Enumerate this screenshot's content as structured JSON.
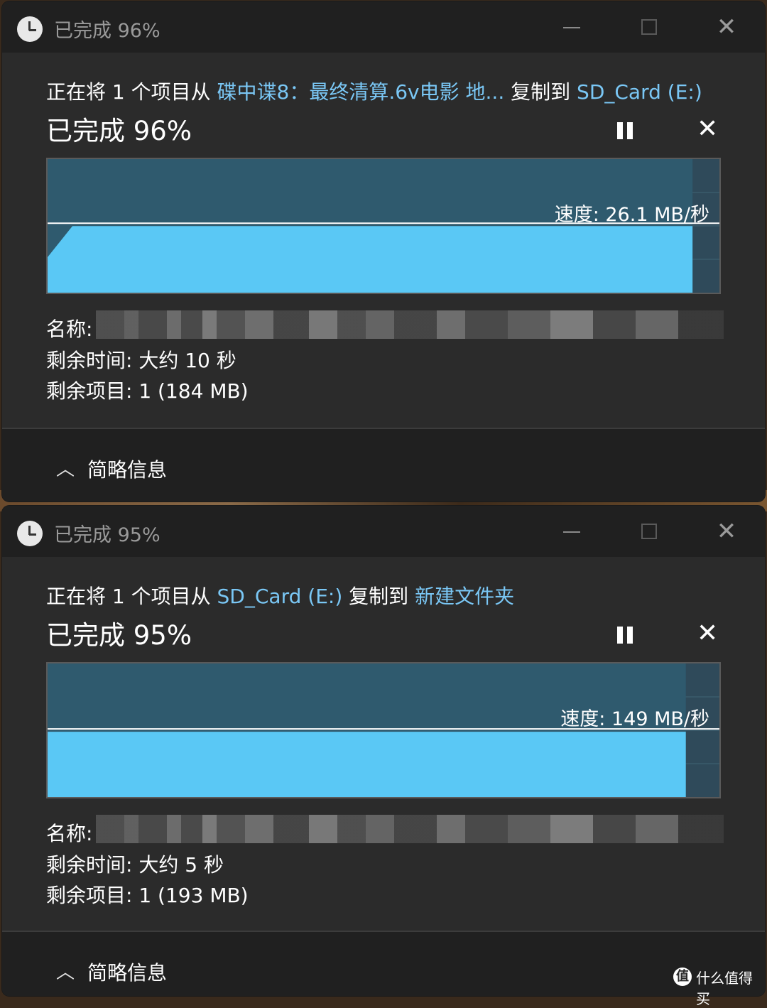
{
  "dialogs": [
    {
      "window_title": "已完成 96%",
      "copy_prefix": "正在将 1 个项目从 ",
      "source": "碟中谍8：最终清算.6v电影 地...",
      "copy_mid": " 复制到 ",
      "destination": "SD_Card (E:)",
      "percent_text": "已完成 96%",
      "progress": 0.96,
      "speed_text": "速度: 26.1 MB/秒",
      "speed_level": 0.52,
      "name_label": "名称:",
      "time_left": "剩余时间: 大约 10 秒",
      "items_left": "剩余项目: 1 (184 MB)",
      "collapse_label": "简略信息"
    },
    {
      "window_title": "已完成 95%",
      "copy_prefix": "正在将 1 个项目从 ",
      "source": "SD_Card (E:)",
      "copy_mid": " 复制到 ",
      "destination": "新建文件夹",
      "percent_text": "已完成 95%",
      "progress": 0.95,
      "speed_text": "速度: 149 MB/秒",
      "speed_level": 0.51,
      "name_label": "名称:",
      "time_left": "剩余时间: 大约 5 秒",
      "items_left": "剩余项目: 1 (193 MB)",
      "collapse_label": "简略信息"
    }
  ],
  "watermark": {
    "mark": "值",
    "text": "什么值得买"
  },
  "colors": {
    "fill": "#5ac8f5",
    "graph_bg": "#2f4a5a",
    "link": "#7ac7f5"
  }
}
